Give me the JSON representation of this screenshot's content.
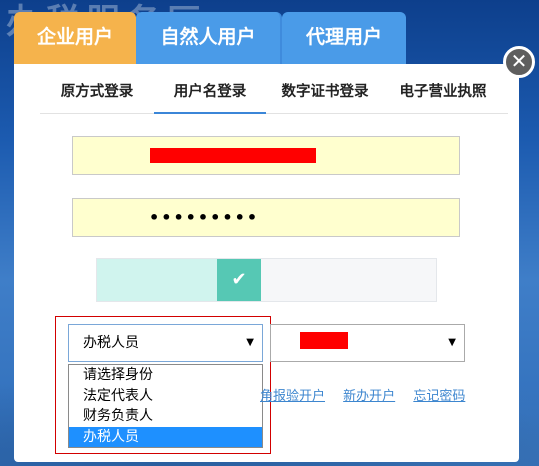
{
  "background": {
    "watermark_text": "办税服务厅"
  },
  "role_tabs": [
    {
      "label": "企业用户",
      "active": true
    },
    {
      "label": "自然人用户",
      "active": false
    },
    {
      "label": "代理用户",
      "active": false
    }
  ],
  "close_icon": "close-icon",
  "login_tabs": [
    {
      "label": "原方式登录"
    },
    {
      "label": "用户名登录",
      "active": true
    },
    {
      "label": "数字证书登录"
    },
    {
      "label": "电子营业执照"
    }
  ],
  "form": {
    "username_value": "",
    "password_value": "•••••••••",
    "slider_check_icon": "check-icon",
    "role_select_value": "办税人员",
    "tax_select_value": "",
    "role_options": [
      "请选择身份",
      "法定代表人",
      "财务负责人",
      "办税人员"
    ]
  },
  "links": {
    "open_account": "角报验开户",
    "new_account": "新办开户",
    "forgot_password": "忘记密码"
  },
  "colors": {
    "active_tab": "#f5b34c",
    "inactive_tab": "#4a9be8",
    "input_bg": "#ffffcf",
    "slider_handle": "#56c8b4",
    "selected_option": "#1e90ff",
    "redaction": "#ff0000"
  }
}
